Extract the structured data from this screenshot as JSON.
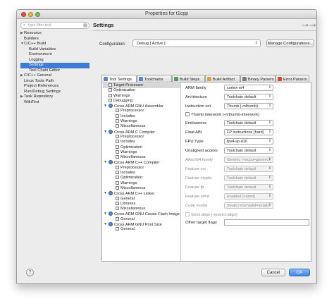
{
  "window": {
    "title": "Properties for t1cpp"
  },
  "filter": {
    "placeholder": "type filter text"
  },
  "nav": [
    {
      "label": "Resource",
      "level": 0,
      "arrow": "right"
    },
    {
      "label": "Builders",
      "level": 0,
      "arrow": ""
    },
    {
      "label": "C/C++ Build",
      "level": 0,
      "arrow": "down"
    },
    {
      "label": "Build Variables",
      "level": 1,
      "arrow": ""
    },
    {
      "label": "Environment",
      "level": 1,
      "arrow": ""
    },
    {
      "label": "Logging",
      "level": 1,
      "arrow": ""
    },
    {
      "label": "Settings",
      "level": 1,
      "arrow": "",
      "selected": true
    },
    {
      "label": "Tool Chain Editor",
      "level": 1,
      "arrow": ""
    },
    {
      "label": "C/C++ General",
      "level": 0,
      "arrow": "right"
    },
    {
      "label": "Linux Tools Path",
      "level": 0,
      "arrow": ""
    },
    {
      "label": "Project References",
      "level": 0,
      "arrow": ""
    },
    {
      "label": "Run/Debug Settings",
      "level": 0,
      "arrow": ""
    },
    {
      "label": "Task Repository",
      "level": 0,
      "arrow": "right"
    },
    {
      "label": "WikiText",
      "level": 0,
      "arrow": ""
    }
  ],
  "page": {
    "title": "Settings",
    "configuration_label": "Configuration:",
    "configuration_value": "Debug  [ Active ]",
    "manage_button": "Manage Configurations..."
  },
  "tabs": [
    {
      "label": "Tool Settings",
      "active": true,
      "icon_color": "#5a86c8"
    },
    {
      "label": "Toolchains",
      "active": false,
      "icon_color": "#5a86c8"
    },
    {
      "label": "Build Steps",
      "active": false,
      "icon_color": "#4fa05a"
    },
    {
      "label": "Build Artifact",
      "active": false,
      "icon_color": "#d9a24a"
    },
    {
      "label": "Binary Parsers",
      "active": false,
      "icon_color": "#7a7a7a"
    },
    {
      "label": "Error Parsers",
      "active": false,
      "icon_color": "#d04a3c"
    }
  ],
  "tree": [
    {
      "label": "Target Processor",
      "level": 0,
      "type": "leaf",
      "selected": true
    },
    {
      "label": "Optimization",
      "level": 0,
      "type": "leaf"
    },
    {
      "label": "Warnings",
      "level": 0,
      "type": "leaf"
    },
    {
      "label": "Debugging",
      "level": 0,
      "type": "leaf"
    },
    {
      "label": "Cross ARM GNU Assembler",
      "level": 0,
      "type": "group"
    },
    {
      "label": "Preprocessor",
      "level": 1,
      "type": "leaf"
    },
    {
      "label": "Includes",
      "level": 1,
      "type": "leaf"
    },
    {
      "label": "Warnings",
      "level": 1,
      "type": "leaf"
    },
    {
      "label": "Miscellaneous",
      "level": 1,
      "type": "leaf"
    },
    {
      "label": "Cross ARM C Compiler",
      "level": 0,
      "type": "group"
    },
    {
      "label": "Preprocessor",
      "level": 1,
      "type": "leaf"
    },
    {
      "label": "Includes",
      "level": 1,
      "type": "leaf"
    },
    {
      "label": "Optimization",
      "level": 1,
      "type": "leaf"
    },
    {
      "label": "Warnings",
      "level": 1,
      "type": "leaf"
    },
    {
      "label": "Miscellaneous",
      "level": 1,
      "type": "leaf"
    },
    {
      "label": "Cross ARM C++ Compiler",
      "level": 0,
      "type": "group"
    },
    {
      "label": "Preprocessor",
      "level": 1,
      "type": "leaf"
    },
    {
      "label": "Includes",
      "level": 1,
      "type": "leaf"
    },
    {
      "label": "Optimization",
      "level": 1,
      "type": "leaf"
    },
    {
      "label": "Warnings",
      "level": 1,
      "type": "leaf"
    },
    {
      "label": "Miscellaneous",
      "level": 1,
      "type": "leaf"
    },
    {
      "label": "Cross ARM C++ Linker",
      "level": 0,
      "type": "group"
    },
    {
      "label": "General",
      "level": 1,
      "type": "leaf"
    },
    {
      "label": "Libraries",
      "level": 1,
      "type": "leaf"
    },
    {
      "label": "Miscellaneous",
      "level": 1,
      "type": "leaf"
    },
    {
      "label": "Cross ARM GNU Create Flash Image",
      "level": 0,
      "type": "group"
    },
    {
      "label": "General",
      "level": 1,
      "type": "leaf"
    },
    {
      "label": "Cross ARM GNU Print Size",
      "level": 0,
      "type": "group"
    },
    {
      "label": "General",
      "level": 1,
      "type": "leaf"
    }
  ],
  "props": [
    {
      "kind": "combo",
      "label": "ARM family",
      "value": "cortex-m4",
      "enabled": true
    },
    {
      "kind": "combo",
      "label": "Architecture",
      "value": "Toolchain default",
      "enabled": true
    },
    {
      "kind": "combo",
      "label": "Instruction set",
      "value": "Thumb (-mthumb)",
      "enabled": true
    },
    {
      "kind": "check",
      "label": "Thumb interwork (-mthumb-interwork)",
      "enabled": true
    },
    {
      "kind": "combo",
      "label": "Endianness",
      "value": "Toolchain default",
      "enabled": true
    },
    {
      "kind": "combo",
      "label": "Float ABI",
      "value": "FP instructions (hard)",
      "enabled": true
    },
    {
      "kind": "combo",
      "label": "FPU Type",
      "value": "fpv4-sp-d16",
      "enabled": true
    },
    {
      "kind": "combo",
      "label": "Unaligned access",
      "value": "Toolchain default",
      "enabled": true
    },
    {
      "kind": "combo",
      "label": "AArch64 family",
      "value": "Generic (-mcpu=generic)",
      "enabled": false
    },
    {
      "kind": "combo",
      "label": "Feature crc",
      "value": "Toolchain default",
      "enabled": false
    },
    {
      "kind": "combo",
      "label": "Feature crypto",
      "value": "Toolchain default",
      "enabled": false
    },
    {
      "kind": "combo",
      "label": "Feature fp",
      "value": "Toolchain default",
      "enabled": false
    },
    {
      "kind": "combo",
      "label": "Feature simd",
      "value": "Enabled (+simd)",
      "enabled": false
    },
    {
      "kind": "combo",
      "label": "Code model",
      "value": "Small (-mcmodel=small)",
      "enabled": false
    },
    {
      "kind": "check",
      "label": "Strict align (-mstrict-align)",
      "enabled": false
    },
    {
      "kind": "text",
      "label": "Other target flags",
      "value": "",
      "enabled": true
    }
  ],
  "buttons": {
    "help": "?",
    "cancel": "Cancel",
    "ok": "OK"
  }
}
